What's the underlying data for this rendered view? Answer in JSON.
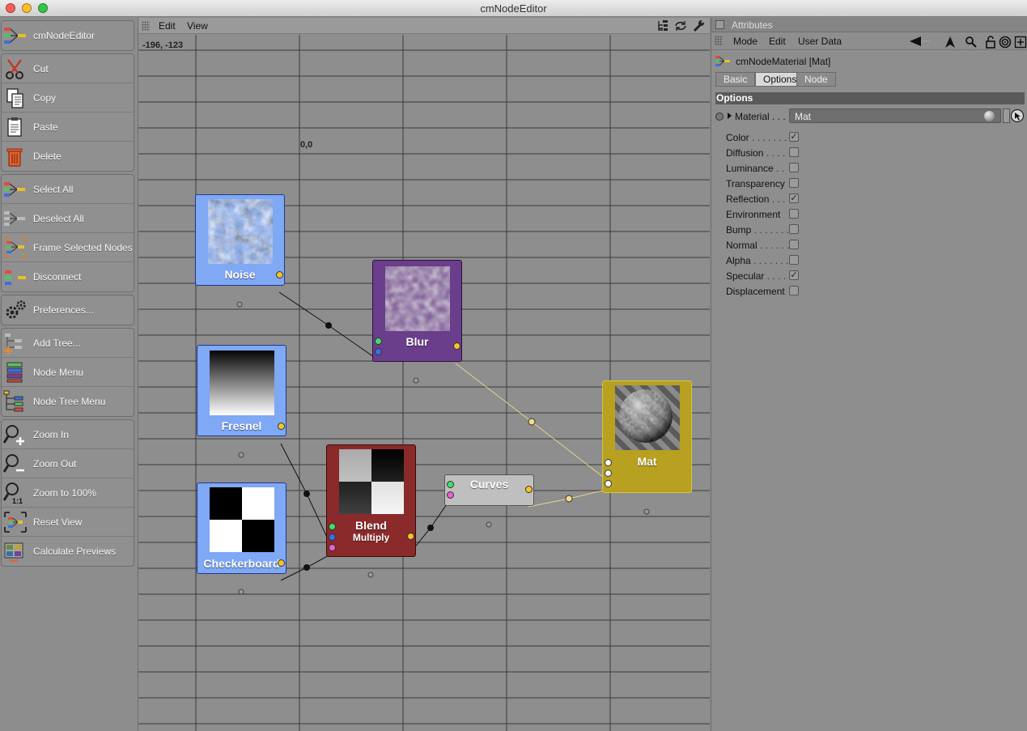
{
  "window": {
    "title": "cmNodeEditor",
    "traffic_colors": [
      "#fc5f57",
      "#fdbc2e",
      "#33c748"
    ]
  },
  "sidebar": {
    "groups": [
      [
        {
          "label": "cmNodeEditor",
          "icon": "node-graph-icon"
        }
      ],
      [
        {
          "label": "Cut",
          "icon": "scissors-icon"
        },
        {
          "label": "Copy",
          "icon": "copy-icon"
        },
        {
          "label": "Paste",
          "icon": "paste-icon"
        },
        {
          "label": "Delete",
          "icon": "trash-icon"
        }
      ],
      [
        {
          "label": "Select All",
          "icon": "select-all-icon"
        },
        {
          "label": "Deselect All",
          "icon": "deselect-all-icon"
        },
        {
          "label": "Frame Selected Nodes",
          "icon": "frame-selected-icon"
        },
        {
          "label": "Disconnect",
          "icon": "disconnect-icon"
        }
      ],
      [
        {
          "label": "Preferences...",
          "icon": "gear-icon"
        }
      ],
      [
        {
          "label": "Add Tree...",
          "icon": "add-tree-icon"
        },
        {
          "label": "Node Menu",
          "icon": "node-menu-icon"
        },
        {
          "label": "Node Tree Menu",
          "icon": "node-tree-icon"
        }
      ],
      [
        {
          "label": "Zoom In",
          "icon": "zoom-in-icon"
        },
        {
          "label": "Zoom Out",
          "icon": "zoom-out-icon"
        },
        {
          "label": "Zoom to 100%",
          "icon": "zoom-100-icon"
        },
        {
          "label": "Reset View",
          "icon": "reset-view-icon"
        },
        {
          "label": "Calculate Previews",
          "icon": "calculate-previews-icon"
        }
      ]
    ]
  },
  "editor": {
    "menu": [
      "Edit",
      "View"
    ],
    "cursor_coords": "-196, -123",
    "origin_label": "0,0",
    "nodes": {
      "noise": {
        "label": "Noise",
        "color": "#7fa8f5"
      },
      "blur": {
        "label": "Blur",
        "color": "#6a3e8a"
      },
      "fresnel": {
        "label": "Fresnel",
        "color": "#7fa8f5"
      },
      "checkerboard": {
        "label": "Checkerboard",
        "color": "#7fa8f5"
      },
      "blend": {
        "label": "Blend",
        "sublabel": "Multiply",
        "color": "#8a2a2a"
      },
      "curves": {
        "label": "Curves",
        "color": "#bfbfbf"
      },
      "mat": {
        "label": "Mat",
        "color": "#b8a020"
      }
    }
  },
  "attributes": {
    "header": "Attributes",
    "menu": [
      "Mode",
      "Edit",
      "User Data"
    ],
    "object_title": "cmNodeMaterial [Mat]",
    "tabs": [
      "Basic",
      "Options",
      "Node"
    ],
    "active_tab": "Options",
    "section": "Options",
    "material_label": "Material . . .",
    "material_value": "Mat",
    "options": [
      {
        "label": "Color",
        "dots": ". . . . . . .",
        "checked": true
      },
      {
        "label": "Diffusion",
        "dots": ". . . .",
        "checked": false
      },
      {
        "label": "Luminance",
        "dots": ". .",
        "checked": false
      },
      {
        "label": "Transparency",
        "dots": "",
        "checked": false
      },
      {
        "label": "Reflection",
        "dots": ". . .",
        "checked": true
      },
      {
        "label": "Environment",
        "dots": "",
        "checked": false
      },
      {
        "label": "Bump",
        "dots": ". . . . . . .",
        "checked": false
      },
      {
        "label": "Normal",
        "dots": ". . . . . .",
        "checked": false
      },
      {
        "label": "Alpha",
        "dots": ". . . . . . .",
        "checked": false
      },
      {
        "label": "Specular",
        "dots": ". . . .",
        "checked": true
      },
      {
        "label": "Displacement",
        "dots": "",
        "checked": false
      }
    ]
  }
}
